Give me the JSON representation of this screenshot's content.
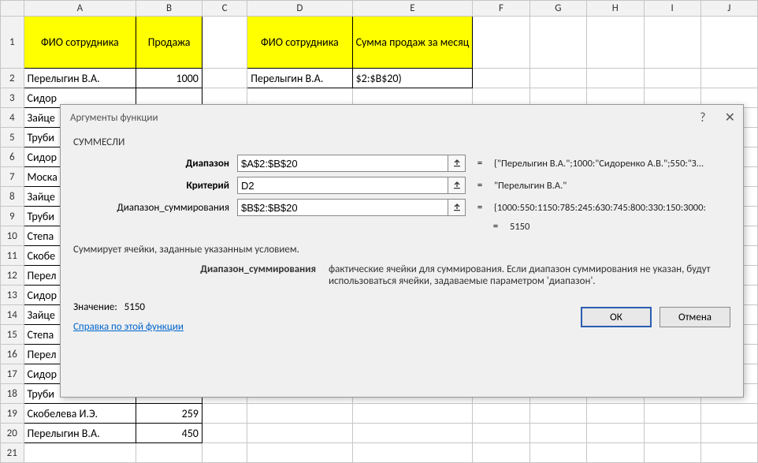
{
  "columns": [
    "A",
    "B",
    "C",
    "D",
    "E",
    "F",
    "G",
    "H",
    "I",
    "J"
  ],
  "headers": {
    "A": "ФИО сотрудника",
    "B": "Продажа",
    "D": "ФИО сотрудника",
    "E": "Сумма продаж за месяц"
  },
  "rows": [
    {
      "n": 1
    },
    {
      "n": 2,
      "A": "Перелыгин В.А.",
      "B": "1000",
      "D": "Перелыгин В.А.",
      "E": "$2:$B$20)"
    },
    {
      "n": 3,
      "A": "Сидор"
    },
    {
      "n": 4,
      "A": "Зайце"
    },
    {
      "n": 5,
      "A": "Труби"
    },
    {
      "n": 6,
      "A": "Сидор"
    },
    {
      "n": 7,
      "A": "Моска"
    },
    {
      "n": 8,
      "A": "Зайце"
    },
    {
      "n": 9,
      "A": "Труби"
    },
    {
      "n": 10,
      "A": "Степа"
    },
    {
      "n": 11,
      "A": "Скобе"
    },
    {
      "n": 12,
      "A": "Перел"
    },
    {
      "n": 13,
      "A": "Сидор"
    },
    {
      "n": 14,
      "A": "Зайце"
    },
    {
      "n": 15,
      "A": "Степа"
    },
    {
      "n": 16,
      "A": "Перел"
    },
    {
      "n": 17,
      "A": "Сидор"
    },
    {
      "n": 18,
      "A": "Труби"
    },
    {
      "n": 19,
      "A": "Скобелева И.Э.",
      "B": "259"
    },
    {
      "n": 20,
      "A": "Перелыгин В.А.",
      "B": "450"
    },
    {
      "n": 21
    }
  ],
  "dialog": {
    "title": "Аргументы функции",
    "help_icon": "?",
    "close_icon": "✕",
    "func": "СУММЕСЛИ",
    "args": [
      {
        "label": "Диапазон",
        "bold": true,
        "value": "$A$2:$B$20",
        "preview": "{\"Перелыгин В.А.\";1000:\"Сидоренко А.В.\";550:\"З..."
      },
      {
        "label": "Критерий",
        "bold": true,
        "value": "D2",
        "preview": "\"Перелыгин В.А.\""
      },
      {
        "label": "Диапазон_суммирования",
        "bold": false,
        "value": "$B$2:$B$20",
        "preview": "{1000:550:1150:785:245:630:745:800:330:150:3000:"
      }
    ],
    "result_preview": "5150",
    "description": "Суммирует ячейки, заданные указанным условием.",
    "hint_label": "Диапазон_суммирования",
    "hint_text": "фактические ячейки для суммирования. Если диапазон суммирования не указан, будут использоваться ячейки, задаваемые параметром 'диапазон'.",
    "value_label": "Значение:",
    "value": "5150",
    "help_link": "Справка по этой функции",
    "ok": "ОК",
    "cancel": "Отмена"
  }
}
